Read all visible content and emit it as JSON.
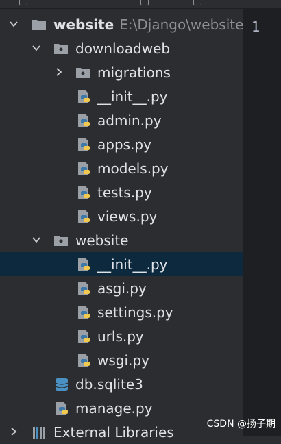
{
  "project": {
    "root_name": "website",
    "root_path": "E:\\Django\\website"
  },
  "tree": [
    {
      "label": "downloadweb",
      "type": "folder",
      "expanded": true
    },
    {
      "label": "migrations",
      "type": "folder",
      "expanded": false
    },
    {
      "label": "__init__.py",
      "type": "python"
    },
    {
      "label": "admin.py",
      "type": "python"
    },
    {
      "label": "apps.py",
      "type": "python"
    },
    {
      "label": "models.py",
      "type": "python"
    },
    {
      "label": "tests.py",
      "type": "python"
    },
    {
      "label": "views.py",
      "type": "python"
    },
    {
      "label": "website",
      "type": "folder",
      "expanded": true
    },
    {
      "label": "__init__.py",
      "type": "python",
      "selected": true
    },
    {
      "label": "asgi.py",
      "type": "python"
    },
    {
      "label": "settings.py",
      "type": "python"
    },
    {
      "label": "urls.py",
      "type": "python"
    },
    {
      "label": "wsgi.py",
      "type": "python"
    },
    {
      "label": "db.sqlite3",
      "type": "database"
    },
    {
      "label": "manage.py",
      "type": "python"
    },
    {
      "label": "External Libraries",
      "type": "libraries"
    }
  ],
  "editor": {
    "line_number": "1"
  },
  "watermark": "CSDN @扬子期",
  "colors": {
    "background": "#2b2d30",
    "selection": "#0d293e",
    "folder": "#9aa0a6",
    "python_blue": "#3c78aa",
    "python_yellow": "#f2c94c",
    "database": "#4a90c2"
  }
}
